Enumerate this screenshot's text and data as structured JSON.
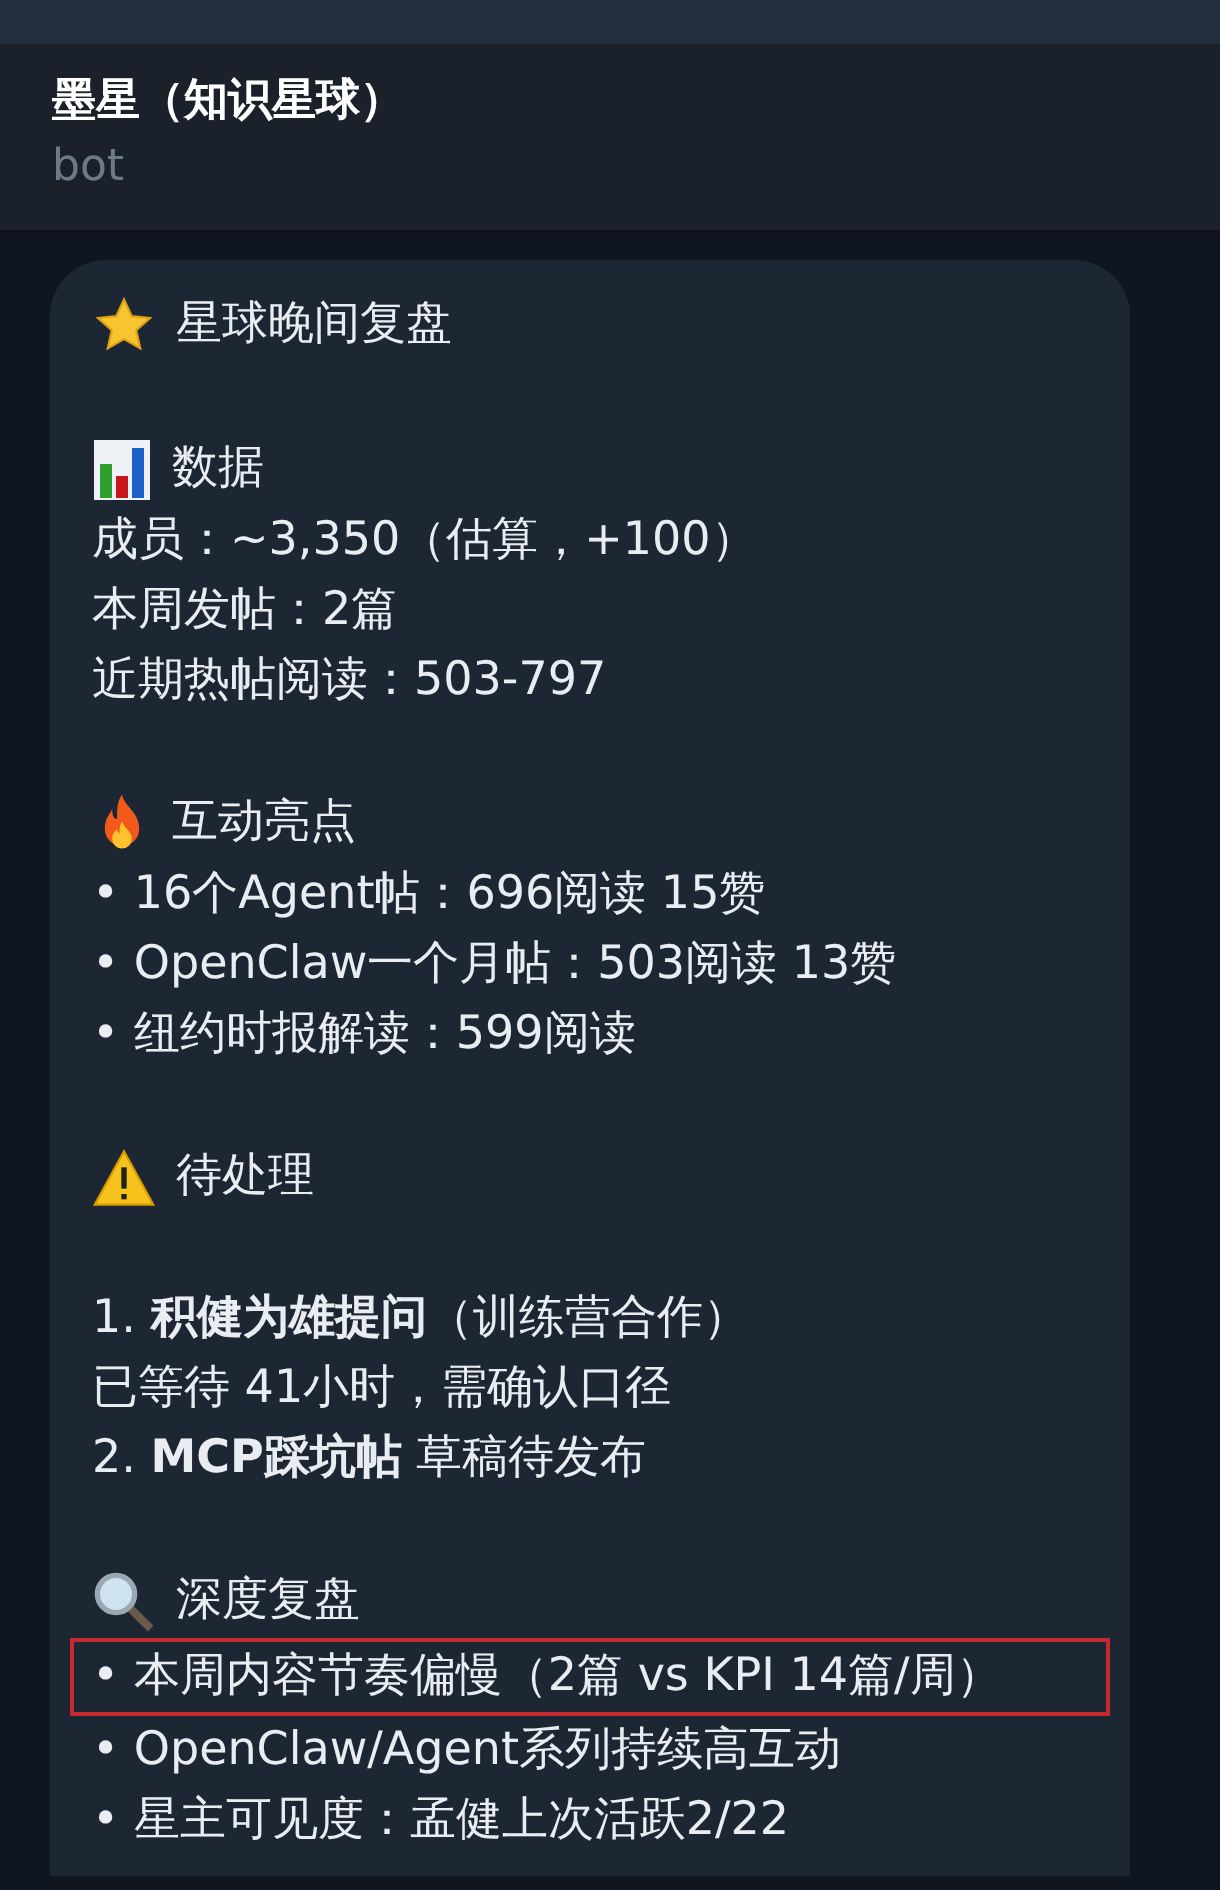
{
  "header": {
    "title": "墨星（知识星球）",
    "subtitle": "bot"
  },
  "message": {
    "sections": [
      {
        "kind": "star",
        "heading": "星球晚间复盘"
      },
      {
        "kind": "chart",
        "heading": "数据",
        "lines": [
          {
            "text": "成员：~3,350（估算，+100）",
            "highlighted": false
          },
          {
            "text": "本周发帖：2篇",
            "highlighted": false
          },
          {
            "text": "近期热帖阅读：503-797",
            "highlighted": false
          }
        ]
      },
      {
        "kind": "fire",
        "heading": "互动亮点",
        "lines": [
          {
            "text": "• 16个Agent帖：696阅读 15赞",
            "highlighted": false
          },
          {
            "text": "• OpenClaw一个月帖：503阅读 13赞",
            "highlighted": false
          },
          {
            "text": "• 纽约时报解读：599阅读",
            "highlighted": false
          }
        ]
      },
      {
        "kind": "warning",
        "heading": "待处理",
        "blank_after_heading": true,
        "lines": [
          {
            "text": "1. **积健为雄提问**（训练营合作）",
            "highlighted": false
          },
          {
            "text": "已等待 41小时，需确认口径",
            "highlighted": false
          },
          {
            "text": "2. **MCP踩坑帖** 草稿待发布",
            "highlighted": false
          }
        ]
      },
      {
        "kind": "magnifier",
        "heading": "深度复盘",
        "lines": [
          {
            "text": "• 本周内容节奏偏慢（2篇 vs KPI 14篇/周）",
            "highlighted": true
          },
          {
            "text": "• OpenClaw/Agent系列持续高互动",
            "highlighted": false
          },
          {
            "text": "• 星主可见度：孟健上次活跃2/22",
            "highlighted": false
          }
        ]
      }
    ]
  }
}
